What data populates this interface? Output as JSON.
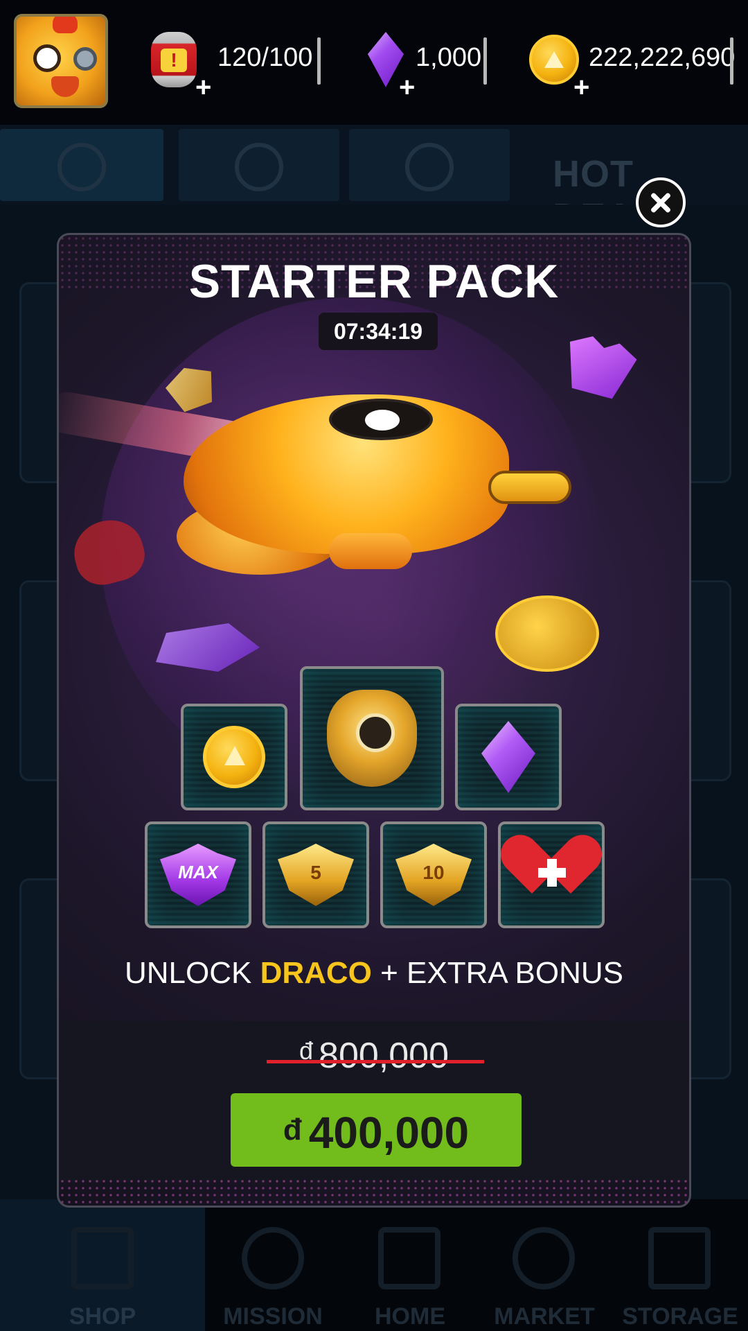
{
  "header": {
    "energy": {
      "icon": "energy-canister-icon",
      "value": "120/100",
      "add_icon": "plus-icon"
    },
    "gems": {
      "icon": "purple-gem-icon",
      "value": "1,000",
      "add_icon": "plus-icon"
    },
    "coins": {
      "icon": "gold-coin-icon",
      "value": "222,222,690",
      "add_icon": "plus-icon"
    },
    "plus_glyph": "+"
  },
  "background": {
    "tab_hot_deal": "HOT DEAL",
    "nav": [
      "SHOP",
      "MISSION",
      "HOME",
      "MARKET",
      "STORAGE"
    ]
  },
  "popup": {
    "title": "STARTER PACK",
    "timer": "07:34:19",
    "rewards_top": [
      {
        "icon": "gold-coin-icon"
      },
      {
        "icon": "draco-ship-icon"
      },
      {
        "icon": "purple-gem-icon"
      }
    ],
    "rewards_bottom": [
      {
        "icon": "max-rank-badge-icon",
        "text": "MAX"
      },
      {
        "icon": "rank-5-badge-icon",
        "text": "5"
      },
      {
        "icon": "rank-10-badge-icon",
        "text": "10"
      },
      {
        "icon": "heart-plus-icon"
      }
    ],
    "unlock_prefix": "UNLOCK",
    "unlock_highlight": "DRACO",
    "unlock_suffix": "+ EXTRA BONUS",
    "currency": "đ",
    "original_price": "800,000",
    "sale_price": "400,000"
  },
  "colors": {
    "buy_button": "#72bd1c",
    "highlight": "#f8c51c",
    "strike": "#e0202a"
  }
}
